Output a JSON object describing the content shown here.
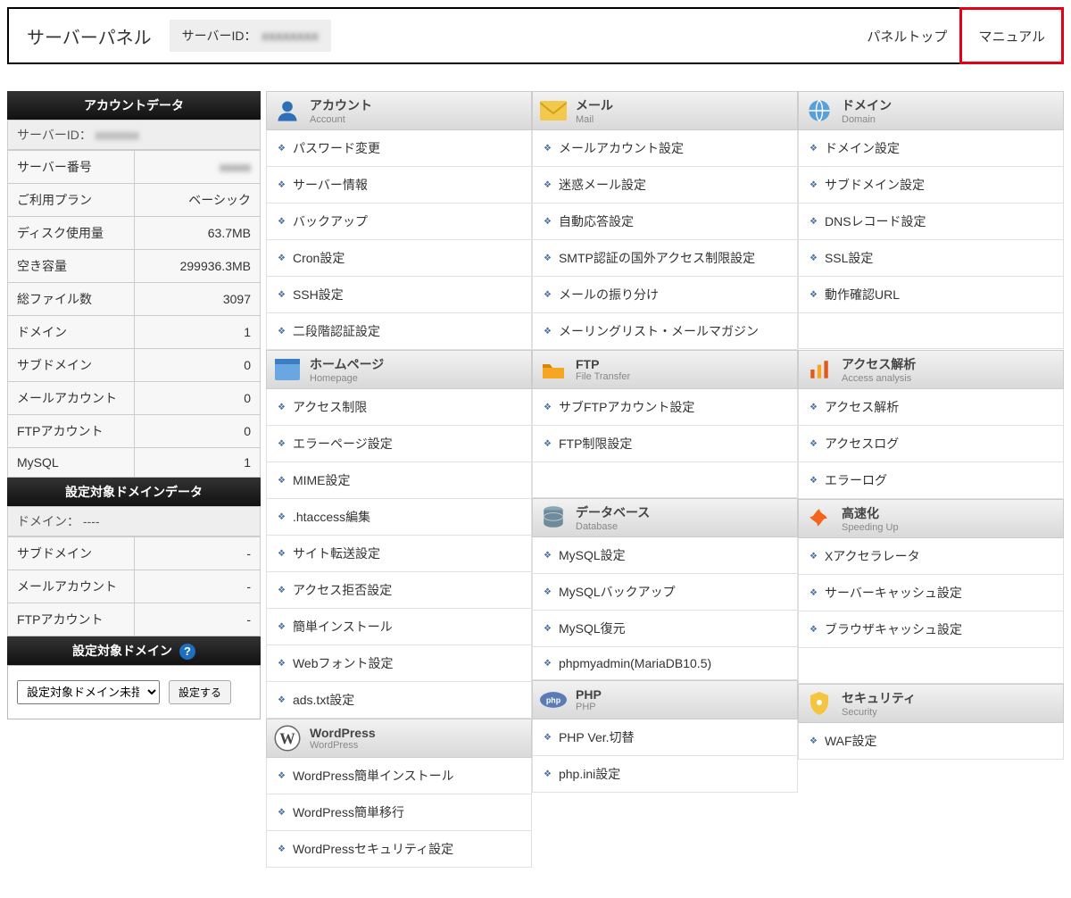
{
  "header": {
    "title": "サーバーパネル",
    "server_id_label": "サーバーID：",
    "panel_top": "パネルトップ",
    "manual": "マニュアル"
  },
  "sidebar": {
    "account_data_title": "アカウントデータ",
    "server_id_label": "サーバーID：",
    "rows": [
      {
        "label": "サーバー番号",
        "value": ""
      },
      {
        "label": "ご利用プラン",
        "value": "ベーシック"
      },
      {
        "label": "ディスク使用量",
        "value": "63.7MB"
      },
      {
        "label": "空き容量",
        "value": "299936.3MB"
      },
      {
        "label": "総ファイル数",
        "value": "3097"
      },
      {
        "label": "ドメイン",
        "value": "1"
      },
      {
        "label": "サブドメイン",
        "value": "0"
      },
      {
        "label": "メールアカウント",
        "value": "0"
      },
      {
        "label": "FTPアカウント",
        "value": "0"
      },
      {
        "label": "MySQL",
        "value": "1"
      }
    ],
    "domain_data_title": "設定対象ドメインデータ",
    "domain_label": "ドメイン：",
    "domain_value": "----",
    "domain_rows": [
      {
        "label": "サブドメイン",
        "value": "-"
      },
      {
        "label": "メールアカウント",
        "value": "-"
      },
      {
        "label": "FTPアカウント",
        "value": "-"
      }
    ],
    "target_domain_title": "設定対象ドメイン",
    "select_placeholder": "設定対象ドメイン未指定",
    "set_button": "設定する"
  },
  "categories": {
    "account": {
      "jp": "アカウント",
      "en": "Account",
      "links": [
        "パスワード変更",
        "サーバー情報",
        "バックアップ",
        "Cron設定",
        "SSH設定",
        "二段階認証設定"
      ]
    },
    "mail": {
      "jp": "メール",
      "en": "Mail",
      "links": [
        "メールアカウント設定",
        "迷惑メール設定",
        "自動応答設定",
        "SMTP認証の国外アクセス制限設定",
        "メールの振り分け",
        "メーリングリスト・メールマガジン"
      ]
    },
    "domain": {
      "jp": "ドメイン",
      "en": "Domain",
      "links": [
        "ドメイン設定",
        "サブドメイン設定",
        "DNSレコード設定",
        "SSL設定",
        "動作確認URL"
      ]
    },
    "homepage": {
      "jp": "ホームページ",
      "en": "Homepage",
      "links": [
        "アクセス制限",
        "エラーページ設定",
        "MIME設定",
        ".htaccess編集",
        "サイト転送設定",
        "アクセス拒否設定",
        "簡単インストール",
        "Webフォント設定",
        "ads.txt設定"
      ]
    },
    "ftp": {
      "jp": "FTP",
      "en": "File Transfer",
      "links": [
        "サブFTPアカウント設定",
        "FTP制限設定"
      ]
    },
    "access": {
      "jp": "アクセス解析",
      "en": "Access analysis",
      "links": [
        "アクセス解析",
        "アクセスログ",
        "エラーログ"
      ]
    },
    "database": {
      "jp": "データベース",
      "en": "Database",
      "links": [
        "MySQL設定",
        "MySQLバックアップ",
        "MySQL復元",
        "phpmyadmin(MariaDB10.5)"
      ]
    },
    "speed": {
      "jp": "高速化",
      "en": "Speeding Up",
      "links": [
        "Xアクセラレータ",
        "サーバーキャッシュ設定",
        "ブラウザキャッシュ設定"
      ]
    },
    "wordpress": {
      "jp": "WordPress",
      "en": "WordPress",
      "links": [
        "WordPress簡単インストール",
        "WordPress簡単移行",
        "WordPressセキュリティ設定"
      ]
    },
    "php": {
      "jp": "PHP",
      "en": "PHP",
      "links": [
        "PHP Ver.切替",
        "php.ini設定"
      ]
    },
    "security": {
      "jp": "セキュリティ",
      "en": "Security",
      "links": [
        "WAF設定"
      ]
    }
  }
}
